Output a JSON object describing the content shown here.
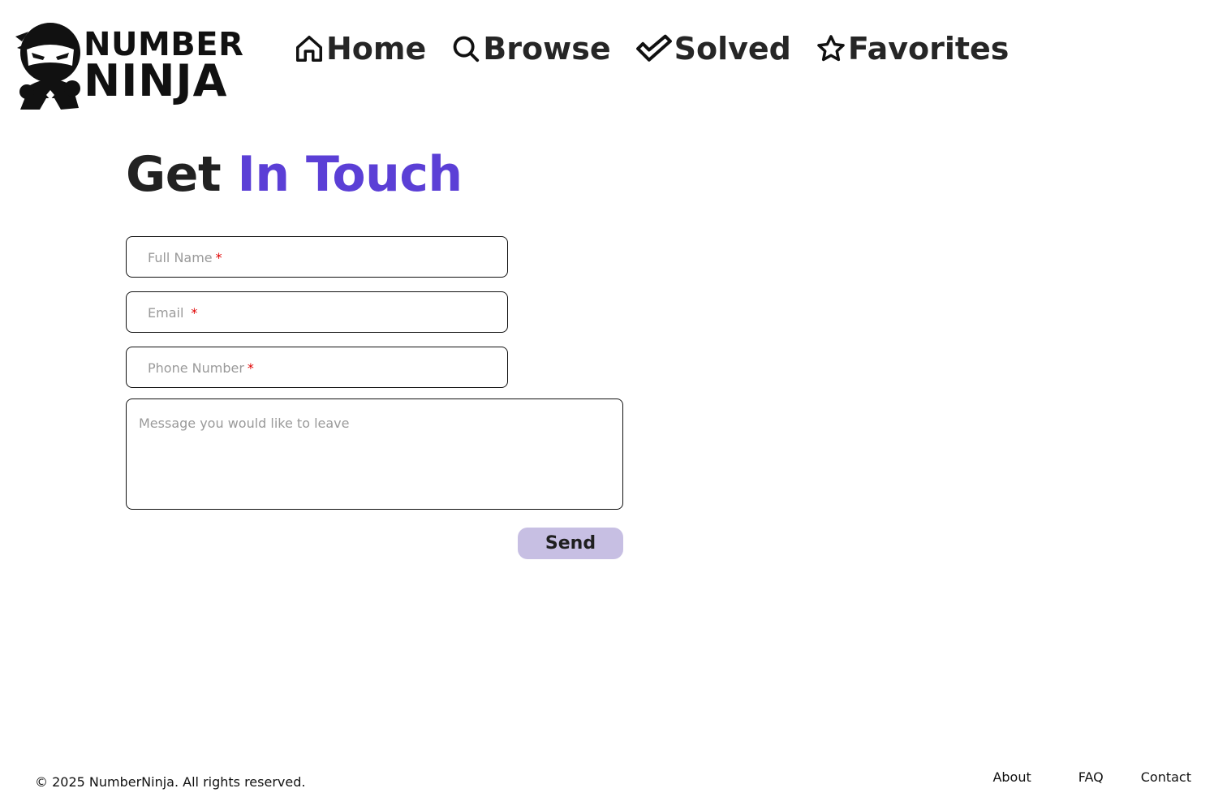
{
  "logo": {
    "line1": "NUMBER",
    "line2": "NINJA"
  },
  "nav": {
    "items": [
      {
        "label": "Home",
        "icon": "home-icon"
      },
      {
        "label": "Browse",
        "icon": "search-icon"
      },
      {
        "label": "Solved",
        "icon": "checkmark-icon"
      },
      {
        "label": "Favorites",
        "icon": "star-icon"
      }
    ]
  },
  "heading": {
    "part1": "Get",
    "part2": "In Touch"
  },
  "form": {
    "full_name_placeholder": "Full Name",
    "email_placeholder": "Email",
    "phone_placeholder": "Phone Number",
    "required_mark": "*",
    "message_placeholder": "Message you would like to leave",
    "send_label": "Send"
  },
  "footer": {
    "copyright": "© 2025 NumberNinja. All rights reserved.",
    "links": [
      "About",
      "FAQ",
      "Contact"
    ]
  },
  "colors": {
    "accent": "#5b3fd6",
    "send_button_bg": "#c7bfe3",
    "required": "#e00000"
  }
}
